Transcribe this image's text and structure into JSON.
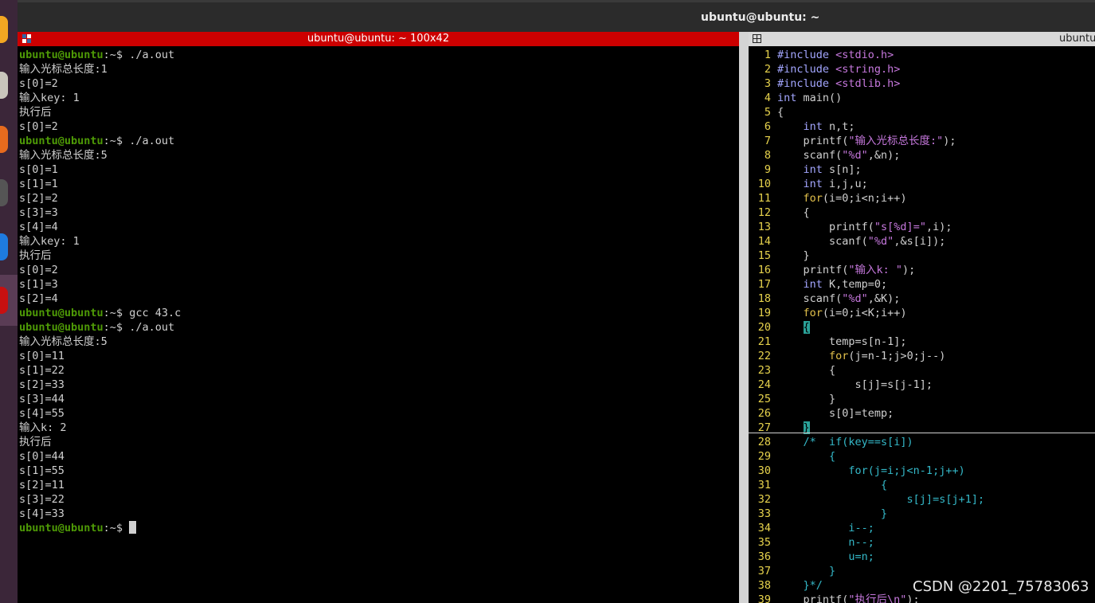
{
  "desktop": {
    "title": "ubuntu@ubuntu: ~"
  },
  "left_terminal": {
    "title": "ubuntu@ubuntu: ~ 100x42",
    "lines": [
      {
        "prompt": "ubuntu@ubuntu",
        "cwd": ":~$ ",
        "text": "./a.out"
      },
      {
        "text": "输入光标总长度:1"
      },
      {
        "text": "s[0]=2"
      },
      {
        "text": "输入key: 1"
      },
      {
        "text": "执行后"
      },
      {
        "text": "s[0]=2"
      },
      {
        "prompt": "ubuntu@ubuntu",
        "cwd": ":~$ ",
        "text": "./a.out"
      },
      {
        "text": "输入光标总长度:5"
      },
      {
        "text": "s[0]=1"
      },
      {
        "text": "s[1]=1"
      },
      {
        "text": "s[2]=2"
      },
      {
        "text": "s[3]=3"
      },
      {
        "text": "s[4]=4"
      },
      {
        "text": "输入key: 1"
      },
      {
        "text": "执行后"
      },
      {
        "text": "s[0]=2"
      },
      {
        "text": "s[1]=3"
      },
      {
        "text": "s[2]=4"
      },
      {
        "prompt": "ubuntu@ubuntu",
        "cwd": ":~$ ",
        "text": "gcc 43.c"
      },
      {
        "prompt": "ubuntu@ubuntu",
        "cwd": ":~$ ",
        "text": "./a.out"
      },
      {
        "text": "输入光标总长度:5"
      },
      {
        "text": "s[0]=11"
      },
      {
        "text": "s[1]=22"
      },
      {
        "text": "s[2]=33"
      },
      {
        "text": "s[3]=44"
      },
      {
        "text": "s[4]=55"
      },
      {
        "text": "输入k: 2"
      },
      {
        "text": "执行后"
      },
      {
        "text": "s[0]=44"
      },
      {
        "text": "s[1]=55"
      },
      {
        "text": "s[2]=11"
      },
      {
        "text": "s[3]=22"
      },
      {
        "text": "s[4]=33"
      },
      {
        "prompt": "ubuntu@ubuntu",
        "cwd": ":~$ ",
        "text": "",
        "cursor": true
      }
    ]
  },
  "right_terminal": {
    "title": "ubuntu",
    "code": [
      {
        "n": "1",
        "segs": [
          {
            "c": "pp",
            "t": "#include "
          },
          {
            "c": "st",
            "t": "<stdio.h>"
          }
        ]
      },
      {
        "n": "2",
        "segs": [
          {
            "c": "pp",
            "t": "#include "
          },
          {
            "c": "st",
            "t": "<string.h>"
          }
        ]
      },
      {
        "n": "3",
        "segs": [
          {
            "c": "pp",
            "t": "#include "
          },
          {
            "c": "st",
            "t": "<stdlib.h>"
          }
        ]
      },
      {
        "n": "4",
        "segs": [
          {
            "c": "ty",
            "t": "int"
          },
          {
            "c": "",
            "t": " main()"
          }
        ]
      },
      {
        "n": "5",
        "segs": [
          {
            "c": "",
            "t": "{"
          }
        ]
      },
      {
        "n": "6",
        "segs": [
          {
            "c": "",
            "t": "    "
          },
          {
            "c": "ty",
            "t": "int"
          },
          {
            "c": "",
            "t": " n,t;"
          }
        ]
      },
      {
        "n": "7",
        "segs": [
          {
            "c": "",
            "t": "    printf("
          },
          {
            "c": "st",
            "t": "\"输入光标总长度:\""
          },
          {
            "c": "",
            "t": ");"
          }
        ]
      },
      {
        "n": "8",
        "segs": [
          {
            "c": "",
            "t": "    scanf("
          },
          {
            "c": "st",
            "t": "\"%d\""
          },
          {
            "c": "",
            "t": ",&n);"
          }
        ]
      },
      {
        "n": "9",
        "segs": [
          {
            "c": "",
            "t": "    "
          },
          {
            "c": "ty",
            "t": "int"
          },
          {
            "c": "",
            "t": " s[n];"
          }
        ]
      },
      {
        "n": "10",
        "segs": [
          {
            "c": "",
            "t": "    "
          },
          {
            "c": "ty",
            "t": "int"
          },
          {
            "c": "",
            "t": " i,j,u;"
          }
        ]
      },
      {
        "n": "11",
        "segs": [
          {
            "c": "",
            "t": "    "
          },
          {
            "c": "kw",
            "t": "for"
          },
          {
            "c": "",
            "t": "(i=0;i<n;i++)"
          }
        ]
      },
      {
        "n": "12",
        "segs": [
          {
            "c": "",
            "t": "    {"
          }
        ]
      },
      {
        "n": "13",
        "segs": [
          {
            "c": "",
            "t": "        printf("
          },
          {
            "c": "st",
            "t": "\"s[%d]=\""
          },
          {
            "c": "",
            "t": ",i);"
          }
        ]
      },
      {
        "n": "14",
        "segs": [
          {
            "c": "",
            "t": "        scanf("
          },
          {
            "c": "st",
            "t": "\"%d\""
          },
          {
            "c": "",
            "t": ",&s[i]);"
          }
        ]
      },
      {
        "n": "15",
        "segs": [
          {
            "c": "",
            "t": "    }"
          }
        ]
      },
      {
        "n": "16",
        "segs": [
          {
            "c": "",
            "t": "    printf("
          },
          {
            "c": "st",
            "t": "\"输入k: \""
          },
          {
            "c": "",
            "t": ");"
          }
        ]
      },
      {
        "n": "17",
        "segs": [
          {
            "c": "",
            "t": "    "
          },
          {
            "c": "ty",
            "t": "int"
          },
          {
            "c": "",
            "t": " K,temp=0;"
          }
        ]
      },
      {
        "n": "18",
        "segs": [
          {
            "c": "",
            "t": "    scanf("
          },
          {
            "c": "st",
            "t": "\"%d\""
          },
          {
            "c": "",
            "t": ",&K);"
          }
        ]
      },
      {
        "n": "19",
        "segs": [
          {
            "c": "",
            "t": "    "
          },
          {
            "c": "kw",
            "t": "for"
          },
          {
            "c": "",
            "t": "(i=0;i<K;i++)"
          }
        ]
      },
      {
        "n": "20",
        "segs": [
          {
            "c": "",
            "t": "    "
          },
          {
            "c": "br",
            "t": "{"
          }
        ]
      },
      {
        "n": "21",
        "segs": [
          {
            "c": "",
            "t": "        temp=s[n-1];"
          }
        ]
      },
      {
        "n": "22",
        "segs": [
          {
            "c": "",
            "t": "        "
          },
          {
            "c": "kw",
            "t": "for"
          },
          {
            "c": "",
            "t": "(j=n-1;j>0;j--)"
          }
        ]
      },
      {
        "n": "23",
        "segs": [
          {
            "c": "",
            "t": "        {"
          }
        ]
      },
      {
        "n": "24",
        "segs": [
          {
            "c": "",
            "t": "            s[j]=s[j-1];"
          }
        ]
      },
      {
        "n": "25",
        "segs": [
          {
            "c": "",
            "t": "        }"
          }
        ]
      },
      {
        "n": "26",
        "segs": [
          {
            "c": "",
            "t": "        s[0]=temp;"
          }
        ]
      },
      {
        "n": "27",
        "segs": [
          {
            "c": "",
            "t": "    "
          },
          {
            "c": "br",
            "t": "}"
          }
        ]
      },
      {
        "n": "28",
        "segs": [
          {
            "c": "",
            "t": "    "
          },
          {
            "c": "cm",
            "t": "/*  if(key==s[i])"
          }
        ]
      },
      {
        "n": "29",
        "segs": [
          {
            "c": "cm",
            "t": "        {"
          }
        ]
      },
      {
        "n": "30",
        "segs": [
          {
            "c": "cm",
            "t": "           for(j=i;j<n-1;j++)"
          }
        ]
      },
      {
        "n": "31",
        "segs": [
          {
            "c": "cm",
            "t": "                {"
          }
        ]
      },
      {
        "n": "32",
        "segs": [
          {
            "c": "cm",
            "t": "                    s[j]=s[j+1];"
          }
        ]
      },
      {
        "n": "33",
        "segs": [
          {
            "c": "cm",
            "t": "                }"
          }
        ]
      },
      {
        "n": "34",
        "segs": [
          {
            "c": "cm",
            "t": "           i--;"
          }
        ]
      },
      {
        "n": "35",
        "segs": [
          {
            "c": "cm",
            "t": "           n--;"
          }
        ]
      },
      {
        "n": "36",
        "segs": [
          {
            "c": "cm",
            "t": "           u=n;"
          }
        ]
      },
      {
        "n": "37",
        "segs": [
          {
            "c": "cm",
            "t": "        }"
          }
        ]
      },
      {
        "n": "38",
        "segs": [
          {
            "c": "cm",
            "t": "    }*/"
          }
        ]
      },
      {
        "n": "39",
        "segs": [
          {
            "c": "",
            "t": "    printf("
          },
          {
            "c": "st",
            "t": "\"执行后\\n\""
          },
          {
            "c": "",
            "t": ");"
          }
        ]
      }
    ]
  },
  "watermark": "CSDN @2201_75783063",
  "colors": {
    "title_red": "#cc0000",
    "prompt_green": "#4e9a06",
    "line_number": "#e8d44d"
  }
}
